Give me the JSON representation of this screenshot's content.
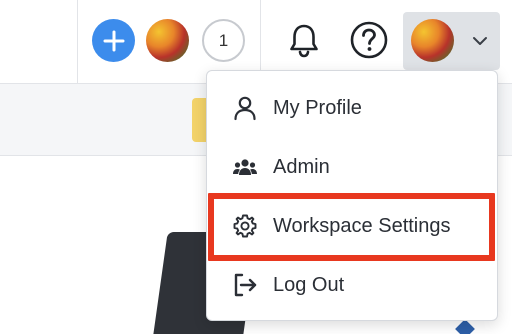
{
  "topbar": {
    "add_icon": "plus-icon",
    "notification_count": "1",
    "notifications_icon": "bell-icon",
    "help_icon": "question-circle-icon",
    "user_menu_chevron": "chevron-down-icon"
  },
  "colors": {
    "primary": "#3c8cec",
    "highlight": "#e8381f"
  },
  "user_menu": {
    "items": [
      {
        "label": "My Profile",
        "icon": "user-icon"
      },
      {
        "label": "Admin",
        "icon": "users-group-icon"
      },
      {
        "label": "Workspace Settings",
        "icon": "gear-icon"
      },
      {
        "label": "Log Out",
        "icon": "log-out-icon"
      }
    ]
  }
}
